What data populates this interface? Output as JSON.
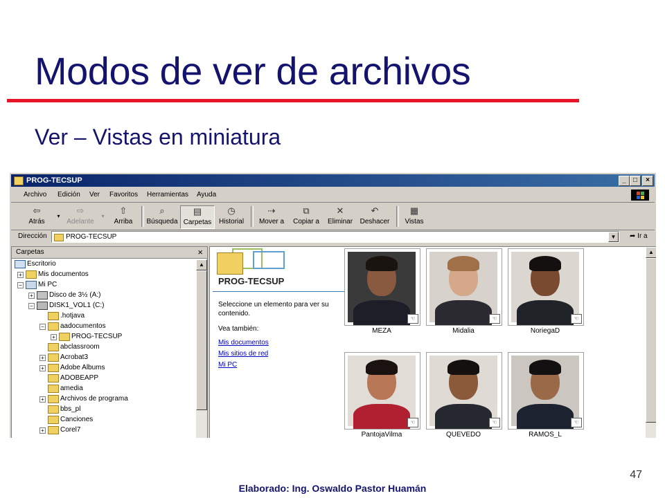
{
  "slide": {
    "title": "Modos de ver de archivos",
    "subtitle": "Ver – Vistas en miniatura",
    "page_number": "47",
    "footer": "Elaborado: Ing. Oswaldo Pastor Huamán"
  },
  "window": {
    "title": "PROG-TECSUP",
    "minimize": "_",
    "maximize": "□",
    "close": "×",
    "menu": [
      "Archivo",
      "Edición",
      "Ver",
      "Favoritos",
      "Herramientas",
      "Ayuda"
    ],
    "toolbar": [
      {
        "label": "Atrás",
        "icon": "back-arrow-icon",
        "glyph": "⇦"
      },
      {
        "label": "Adelante",
        "icon": "forward-arrow-icon",
        "glyph": "⇨",
        "disabled": true
      },
      {
        "label": "Arriba",
        "icon": "up-folder-icon",
        "glyph": "⇧"
      },
      {
        "label": "Búsqueda",
        "icon": "search-icon",
        "glyph": "⌕"
      },
      {
        "label": "Carpetas",
        "icon": "folders-icon",
        "glyph": "▤",
        "pressed": true
      },
      {
        "label": "Historial",
        "icon": "history-icon",
        "glyph": "◷"
      },
      {
        "label": "Mover a",
        "icon": "move-to-icon",
        "glyph": "⇢"
      },
      {
        "label": "Copiar a",
        "icon": "copy-to-icon",
        "glyph": "⧉"
      },
      {
        "label": "Eliminar",
        "icon": "delete-icon",
        "glyph": "✕"
      },
      {
        "label": "Deshacer",
        "icon": "undo-icon",
        "glyph": "↶"
      },
      {
        "label": "Vistas",
        "icon": "views-icon",
        "glyph": "▦"
      }
    ],
    "address_label": "Dirección",
    "address_value": "PROG-TECSUP",
    "go_label": "Ir a",
    "folders_pane_title": "Carpetas",
    "tree": [
      {
        "label": "Escritorio",
        "icon": "desktop-icon"
      },
      {
        "label": "Mis documentos",
        "icon": "folder-icon",
        "pm": "+"
      },
      {
        "label": "Mi PC",
        "icon": "computer-icon",
        "pm": "−"
      },
      {
        "label": "Disco de 3½ (A:)",
        "icon": "floppy-icon",
        "pm": "+"
      },
      {
        "label": "DISK1_VOL1 (C:)",
        "icon": "drive-icon",
        "pm": "−"
      },
      {
        "label": ".hotjava",
        "icon": "folder-icon"
      },
      {
        "label": "aadocumentos",
        "icon": "folder-icon",
        "pm": "−"
      },
      {
        "label": "PROG-TECSUP",
        "icon": "folder-icon",
        "pm": "+"
      },
      {
        "label": "abclassroom",
        "icon": "folder-icon"
      },
      {
        "label": "Acrobat3",
        "icon": "folder-icon",
        "pm": "+"
      },
      {
        "label": "Adobe Albums",
        "icon": "folder-icon",
        "pm": "+"
      },
      {
        "label": "ADOBEAPP",
        "icon": "folder-icon"
      },
      {
        "label": "amedia",
        "icon": "folder-icon"
      },
      {
        "label": "Archivos de programa",
        "icon": "folder-icon",
        "pm": "+"
      },
      {
        "label": "bbs_pl",
        "icon": "folder-icon"
      },
      {
        "label": "Canciones",
        "icon": "folder-icon"
      },
      {
        "label": "Corel7",
        "icon": "folder-icon",
        "pm": "+"
      }
    ],
    "webview": {
      "folder_title": "PROG-TECSUP",
      "description": "Seleccione un elemento para ver su contenido.",
      "see_also": "Vea también:",
      "links": [
        "Mis documentos",
        "Mis sitios de red",
        "Mi PC"
      ]
    },
    "thumbnails": [
      {
        "caption": "MEZA",
        "bg": "#3a3a3a",
        "skin": "#8a5a40",
        "hair": "#1a1410",
        "shirt": "#1e1e28"
      },
      {
        "caption": "Midalia",
        "bg": "#d8d2cc",
        "skin": "#d4a888",
        "hair": "#a07048",
        "shirt": "#2a2a30"
      },
      {
        "caption": "NoriegaD",
        "bg": "#dcd6d0",
        "skin": "#7a4a30",
        "hair": "#141010",
        "shirt": "#202428"
      },
      {
        "caption": "PantojaVilma",
        "bg": "#e2dcd6",
        "skin": "#b87858",
        "hair": "#1a1210",
        "shirt": "#b02030"
      },
      {
        "caption": "QUEVEDO",
        "bg": "#e0dad4",
        "skin": "#8a5a3a",
        "hair": "#141010",
        "shirt": "#262830"
      },
      {
        "caption": "RAMOS_L",
        "bg": "#ccc6c0",
        "skin": "#9a6a48",
        "hair": "#121010",
        "shirt": "#1c2230"
      }
    ]
  },
  "colors": {
    "title": "#14146e",
    "rule": "#e8142a",
    "titlebar_start": "#0a246a",
    "titlebar_end": "#3a6ea5",
    "link": "#0000cc"
  }
}
